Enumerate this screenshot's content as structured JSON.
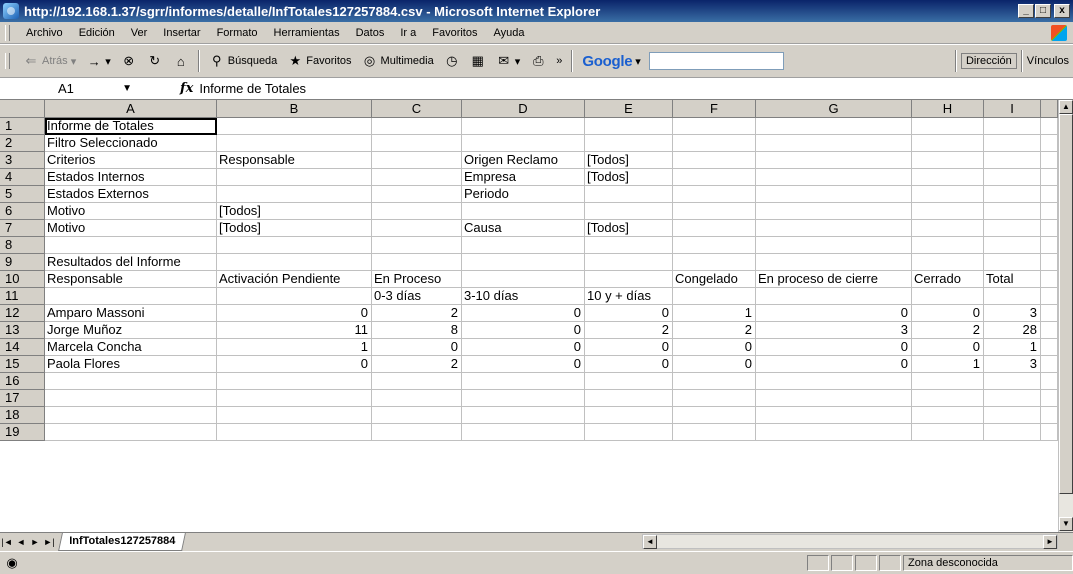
{
  "window": {
    "title": "http://192.168.1.37/sgrr/informes/detalle/InfTotales127257884.csv - Microsoft Internet Explorer",
    "min_glyph": "_",
    "max_glyph": "□",
    "close_glyph": "x"
  },
  "menu": [
    "Archivo",
    "Edición",
    "Ver",
    "Insertar",
    "Formato",
    "Herramientas",
    "Datos",
    "Ir a",
    "Favoritos",
    "Ayuda"
  ],
  "toolbar": {
    "back_label": "Atrás",
    "search_label": "Búsqueda",
    "favorites_label": "Favoritos",
    "multimedia_label": "Multimedia",
    "chevron": "»",
    "google_label": "Google",
    "address_label": "Dirección",
    "links_label": "Vínculos"
  },
  "formula": {
    "cell_ref": "A1",
    "fx": "fx",
    "content": "Informe de Totales"
  },
  "columns": [
    "A",
    "B",
    "C",
    "D",
    "E",
    "F",
    "G",
    "H",
    "I"
  ],
  "rows": [
    [
      "Informe de Totales",
      "",
      "",
      "",
      "",
      "",
      "",
      "",
      ""
    ],
    [
      "Filtro Seleccionado",
      "",
      "",
      "",
      "",
      "",
      "",
      "",
      ""
    ],
    [
      "Criterios",
      "Responsable",
      "",
      "Origen Reclamo",
      "[Todos]",
      "",
      "",
      "",
      ""
    ],
    [
      "Estados Internos",
      "",
      "",
      "Empresa",
      "[Todos]",
      "",
      "",
      "",
      ""
    ],
    [
      "Estados Externos",
      "",
      "",
      "Periodo",
      "",
      "",
      "",
      "",
      ""
    ],
    [
      "Motivo",
      "[Todos]",
      "",
      "",
      "",
      "",
      "",
      "",
      ""
    ],
    [
      "Motivo",
      "[Todos]",
      "",
      "Causa",
      "[Todos]",
      "",
      "",
      "",
      ""
    ],
    [
      "",
      "",
      "",
      "",
      "",
      "",
      "",
      "",
      ""
    ],
    [
      "Resultados del Informe",
      "",
      "",
      "",
      "",
      "",
      "",
      "",
      ""
    ],
    [
      "Responsable",
      "Activación Pendiente",
      "En Proceso",
      "",
      "",
      "Congelado",
      "En proceso de cierre",
      "Cerrado",
      "Total"
    ],
    [
      "",
      "",
      "0-3 días",
      "3-10 días",
      "10 y + días",
      "",
      "",
      "",
      ""
    ],
    [
      "Amparo Massoni",
      "0",
      "2",
      "0",
      "0",
      "1",
      "0",
      "0",
      "3"
    ],
    [
      "Jorge Muñoz",
      "11",
      "8",
      "0",
      "2",
      "2",
      "3",
      "2",
      "28"
    ],
    [
      "Marcela Concha",
      "1",
      "0",
      "0",
      "0",
      "0",
      "0",
      "0",
      "1"
    ],
    [
      "Paola Flores",
      "0",
      "2",
      "0",
      "0",
      "0",
      "0",
      "1",
      "3"
    ],
    [
      "",
      "",
      "",
      "",
      "",
      "",
      "",
      "",
      ""
    ],
    [
      "",
      "",
      "",
      "",
      "",
      "",
      "",
      "",
      ""
    ],
    [
      "",
      "",
      "",
      "",
      "",
      "",
      "",
      "",
      ""
    ],
    [
      "",
      "",
      "",
      "",
      "",
      "",
      "",
      "",
      ""
    ]
  ],
  "row_numbers": [
    "1",
    "2",
    "3",
    "4",
    "5",
    "6",
    "7",
    "8",
    "9",
    "10",
    "11",
    "12",
    "13",
    "14",
    "15",
    "16",
    "17",
    "18",
    "19"
  ],
  "sheet_tab": "InfTotales127257884",
  "status": {
    "zone": "Zona desconocida"
  }
}
